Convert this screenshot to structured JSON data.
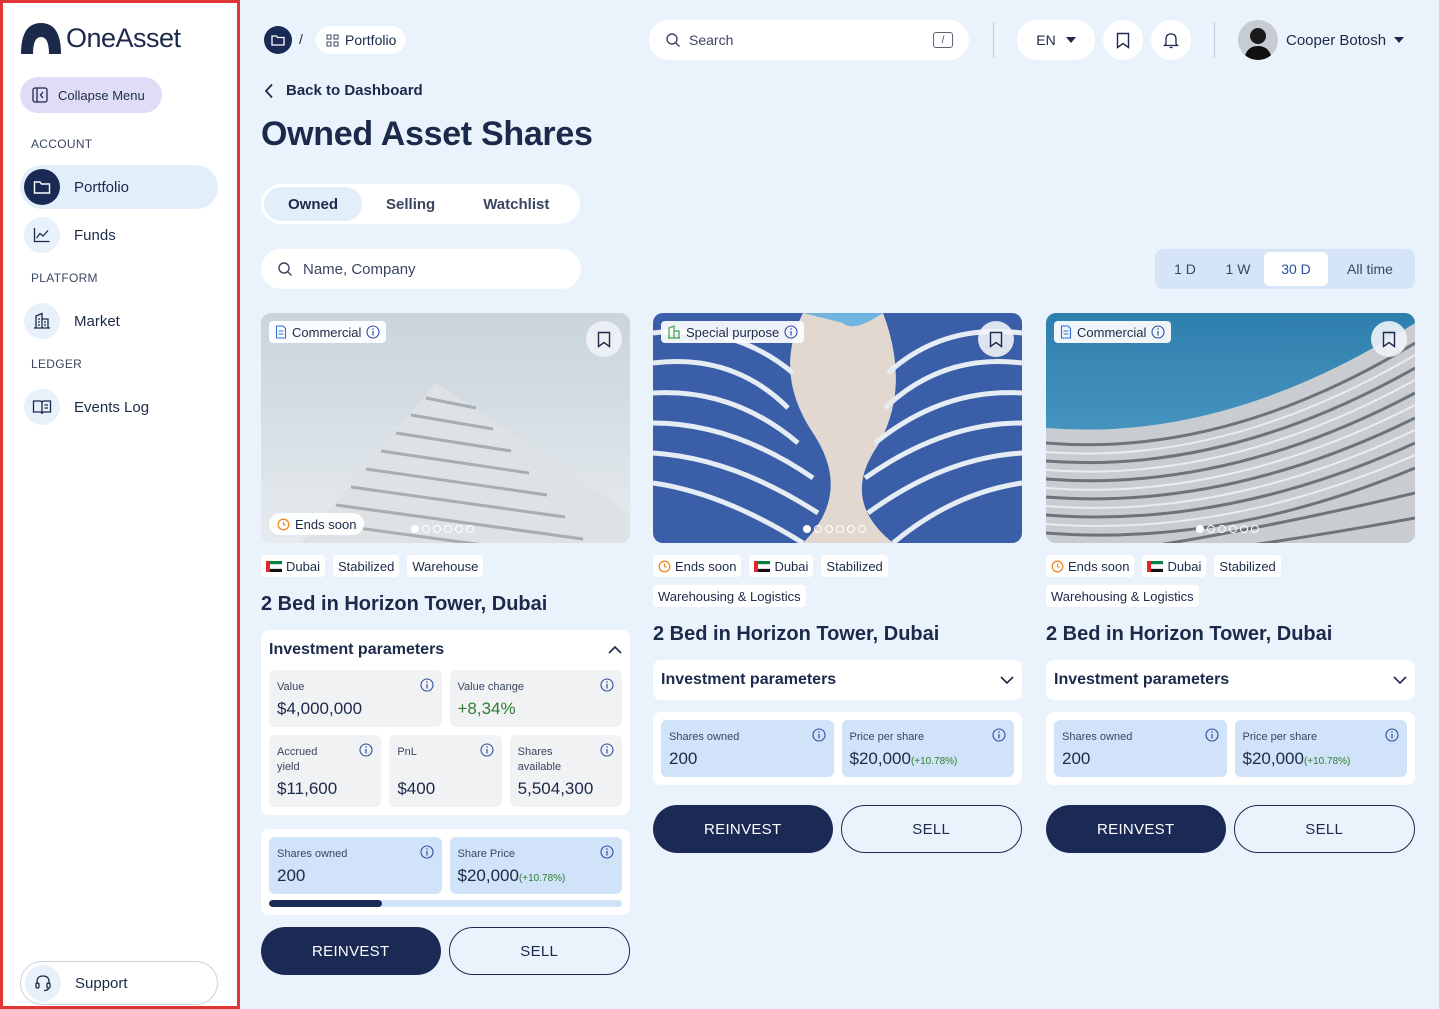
{
  "app": {
    "name": "OneAsset"
  },
  "sidebar": {
    "collapse_label": "Collapse Menu",
    "sections": [
      {
        "label": "ACCOUNT",
        "items": [
          {
            "label": "Portfolio",
            "icon": "folder-icon",
            "active": true
          },
          {
            "label": "Funds",
            "icon": "chart-line-icon"
          }
        ]
      },
      {
        "label": "PLATFORM",
        "items": [
          {
            "label": "Market",
            "icon": "building-icon"
          }
        ]
      },
      {
        "label": "LEDGER",
        "items": [
          {
            "label": "Events Log",
            "icon": "book-icon"
          }
        ]
      }
    ],
    "support_label": "Support"
  },
  "header": {
    "breadcrumb": {
      "separator": "/",
      "current": "Portfolio"
    },
    "search": {
      "placeholder": "Search",
      "shortcut": "/"
    },
    "language": "EN",
    "user": {
      "name": "Cooper Botosh"
    }
  },
  "page": {
    "back_label": "Back to Dashboard",
    "title": "Owned Asset Shares",
    "tabs": [
      "Owned",
      "Selling",
      "Watchlist"
    ],
    "active_tab": "Owned",
    "filter_placeholder": "Name, Company",
    "ranges": [
      "1 D",
      "1 W",
      "30 D",
      "All time"
    ],
    "active_range": "30 D"
  },
  "cards": [
    {
      "type": "Commercial",
      "ends_soon": "Ends soon",
      "tags": [
        "Dubai",
        "Stabilized",
        "Warehouse"
      ],
      "title": "2 Bed in Horizon Tower, Dubai",
      "params_title": "Investment parameters",
      "value_label": "Value",
      "value": "$4,000,000",
      "value_change_label": "Value change",
      "value_change": "+8,34%",
      "accrued_label": "Accrued yield",
      "accrued": "$11,600",
      "pnl_label": "PnL",
      "pnl": "$400",
      "available_label": "Shares available",
      "available": "5,504,300",
      "shares_owned_label": "Shares owned",
      "shares_owned": "200",
      "share_price_label": "Share Price",
      "share_price": "$20,000",
      "share_price_change": "(+10.78%)",
      "progress": 0.32,
      "reinvest": "REINVEST",
      "sell": "SELL"
    },
    {
      "type": "Special purpose",
      "ends_soon": "Ends soon",
      "tags": [
        "Dubai",
        "Stabilized",
        "Warehousing & Logistics"
      ],
      "title": "2 Bed in Horizon Tower, Dubai",
      "params_title": "Investment parameters",
      "shares_owned_label": "Shares owned",
      "shares_owned": "200",
      "price_label": "Price per share",
      "price": "$20,000",
      "price_change": "(+10.78%)",
      "reinvest": "REINVEST",
      "sell": "SELL"
    },
    {
      "type": "Commercial",
      "ends_soon": "Ends soon",
      "tags": [
        "Dubai",
        "Stabilized",
        "Warehousing & Logistics"
      ],
      "title": "2 Bed in Horizon Tower, Dubai",
      "params_title": "Investment parameters",
      "shares_owned_label": "Shares owned",
      "shares_owned": "200",
      "price_label": "Price per share",
      "price": "$20,000",
      "price_change": "(+10.78%)",
      "reinvest": "REINVEST",
      "sell": "SELL"
    }
  ],
  "colors": {
    "primary": "#1b2a55",
    "background": "#eaf3fc",
    "positive": "#2e7d32",
    "highlight": "#e03535"
  }
}
